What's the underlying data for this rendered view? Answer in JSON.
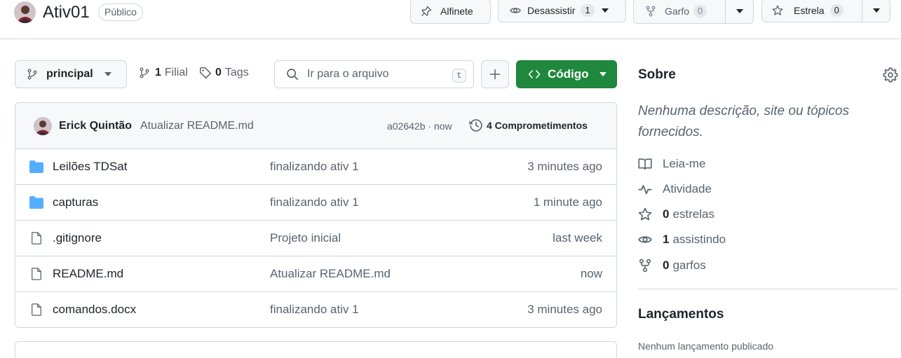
{
  "repo": {
    "name": "Ativ01",
    "visibility": "Público"
  },
  "actions": {
    "pin_label": "Alfinete",
    "watch_label": "Desassistir",
    "watch_count": "1",
    "fork_label": "Garfo",
    "fork_count": "0",
    "star_label": "Estrela",
    "star_count": "0"
  },
  "toolbar": {
    "branch": "principal",
    "branches_count": "1",
    "branches_label": "Filial",
    "tags_count": "0",
    "tags_label": "Tags",
    "search_placeholder": "Ir para o arquivo",
    "search_shortcut": "t",
    "code_label": "Código"
  },
  "latest_commit": {
    "author": "Erick Quintão",
    "message": "Atualizar README.md",
    "hash_time": "a02642b · now",
    "commits_label": "4 Comprometimentos"
  },
  "files": [
    {
      "name": "Leilões TDSat",
      "type": "folder",
      "commit": "finalizando ativ 1",
      "age": "3 minutes ago"
    },
    {
      "name": "capturas",
      "type": "folder",
      "commit": "finalizando ativ 1",
      "age": "1 minute ago"
    },
    {
      "name": ".gitignore",
      "type": "file",
      "commit": "Projeto inicial",
      "age": "last week"
    },
    {
      "name": "README.md",
      "type": "file",
      "commit": "Atualizar README.md",
      "age": "now"
    },
    {
      "name": "comandos.docx",
      "type": "file",
      "commit": "finalizando ativ 1",
      "age": "3 minutes ago"
    }
  ],
  "sidebar": {
    "about_title": "Sobre",
    "description": "Nenhuma descrição, site ou tópicos fornecidos.",
    "readme_label": "Leia-me",
    "activity_label": "Atividade",
    "stars_count": "0",
    "stars_label": "estrelas",
    "watching_count": "1",
    "watching_label": "assistindo",
    "forks_count": "0",
    "forks_label": "garfos",
    "releases_title": "Lançamentos",
    "releases_empty": "Nenhum lançamento publicado"
  },
  "colors": {
    "accent_green": "#1f883d",
    "folder_blue": "#54aeff",
    "border": "#d0d7de",
    "muted_text": "#59636e"
  },
  "icons": [
    "avatar",
    "pin-icon",
    "eye-icon",
    "repo-forked-icon",
    "star-icon",
    "triangle-down-icon",
    "git-branch-icon",
    "tag-icon",
    "search-icon",
    "plus-icon",
    "code-icon",
    "history-icon",
    "folder-icon",
    "file-icon",
    "gear-icon",
    "book-icon",
    "pulse-icon"
  ]
}
